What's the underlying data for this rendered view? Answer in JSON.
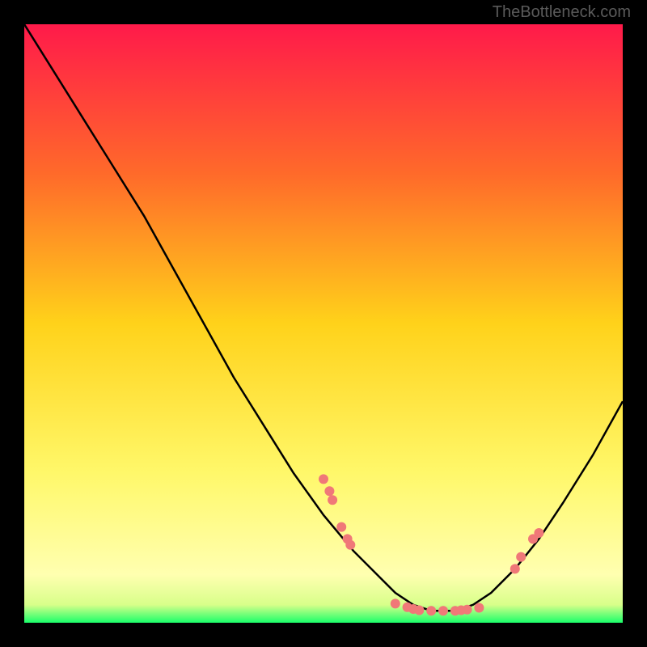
{
  "watermark": "TheBottleneck.com",
  "chart_data": {
    "type": "line",
    "title": "",
    "xlabel": "",
    "ylabel": "",
    "xlim": [
      0,
      100
    ],
    "ylim": [
      0,
      100
    ],
    "gradient_stops": [
      {
        "offset": 0,
        "color": "#ff1a4a"
      },
      {
        "offset": 25,
        "color": "#ff6a2a"
      },
      {
        "offset": 50,
        "color": "#ffd21a"
      },
      {
        "offset": 75,
        "color": "#fff86a"
      },
      {
        "offset": 92,
        "color": "#ffffb0"
      },
      {
        "offset": 97,
        "color": "#d8ff8a"
      },
      {
        "offset": 100,
        "color": "#1aff6a"
      }
    ],
    "series": [
      {
        "name": "bottleneck-curve",
        "color": "#000000",
        "x": [
          0,
          5,
          10,
          15,
          20,
          25,
          30,
          35,
          40,
          45,
          50,
          55,
          60,
          62,
          65,
          68,
          72,
          75,
          78,
          82,
          86,
          90,
          95,
          100
        ],
        "y": [
          100,
          92,
          84,
          76,
          68,
          59,
          50,
          41,
          33,
          25,
          18,
          12,
          7,
          5,
          3,
          2,
          2,
          3,
          5,
          9,
          14,
          20,
          28,
          37
        ]
      }
    ],
    "scatter_points": {
      "name": "markers",
      "color": "#f07878",
      "points": [
        {
          "x": 50,
          "y": 24
        },
        {
          "x": 51,
          "y": 22
        },
        {
          "x": 51.5,
          "y": 20.5
        },
        {
          "x": 53,
          "y": 16
        },
        {
          "x": 54,
          "y": 14
        },
        {
          "x": 54.5,
          "y": 13
        },
        {
          "x": 62,
          "y": 3.2
        },
        {
          "x": 64,
          "y": 2.6
        },
        {
          "x": 65,
          "y": 2.3
        },
        {
          "x": 66,
          "y": 2.1
        },
        {
          "x": 68,
          "y": 2.0
        },
        {
          "x": 70,
          "y": 2.0
        },
        {
          "x": 72,
          "y": 2.0
        },
        {
          "x": 73,
          "y": 2.1
        },
        {
          "x": 74,
          "y": 2.2
        },
        {
          "x": 76,
          "y": 2.5
        },
        {
          "x": 82,
          "y": 9
        },
        {
          "x": 83,
          "y": 11
        },
        {
          "x": 85,
          "y": 14
        },
        {
          "x": 86,
          "y": 15
        }
      ]
    }
  }
}
